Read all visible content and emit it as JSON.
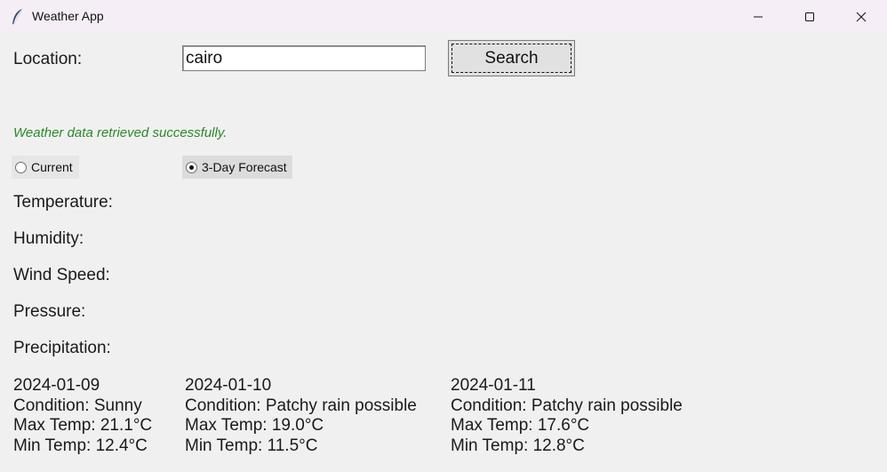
{
  "window": {
    "title": "Weather App",
    "icon": "feather-icon",
    "controls": [
      "minimize-icon",
      "maximize-icon",
      "close-icon"
    ]
  },
  "search": {
    "label": "Location:",
    "value": "cairo",
    "button_label": "Search"
  },
  "status": {
    "message": "Weather data retrieved successfully.",
    "color": "#2a8a2a"
  },
  "mode": {
    "options": [
      "Current",
      "3-Day Forecast"
    ],
    "selected": "3-Day Forecast"
  },
  "fields": {
    "temperature": "Temperature:",
    "humidity": "Humidity:",
    "wind_speed": "Wind Speed:",
    "pressure": "Pressure:",
    "precipitation": "Precipitation:"
  },
  "forecast": [
    {
      "date": "2024-01-09",
      "condition": "Condition: Sunny",
      "max_temp": "Max Temp: 21.1°C",
      "min_temp": "Min Temp: 12.4°C"
    },
    {
      "date": "2024-01-10",
      "condition": "Condition: Patchy rain possible",
      "max_temp": "Max Temp: 19.0°C",
      "min_temp": "Min Temp: 11.5°C"
    },
    {
      "date": "2024-01-11",
      "condition": "Condition: Patchy rain possible",
      "max_temp": "Max Temp: 17.6°C",
      "min_temp": "Min Temp: 12.8°C"
    }
  ]
}
